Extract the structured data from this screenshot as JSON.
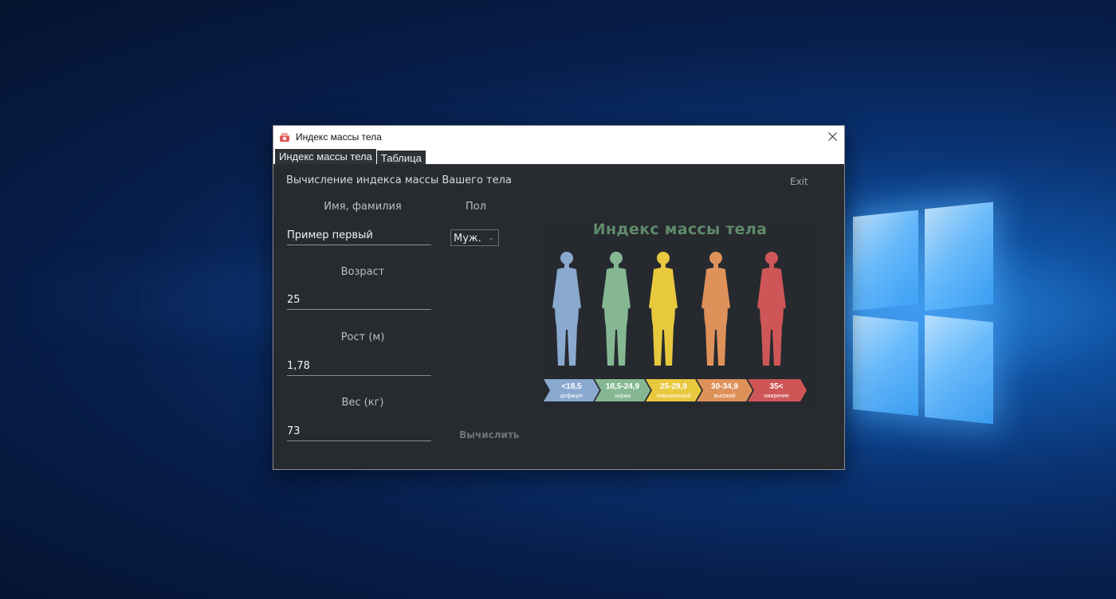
{
  "window": {
    "title": "Индекс массы тела",
    "tabs": [
      {
        "label": "Индекс массы тела",
        "active": true
      },
      {
        "label": "Таблица",
        "active": false
      }
    ]
  },
  "main": {
    "heading": "Вычисление индекса массы Вашего тела",
    "exit_label": "Exit",
    "name": {
      "label": "Имя, фамилия",
      "value": "Пример первый"
    },
    "gender": {
      "label": "Пол",
      "selected": "Муж."
    },
    "age": {
      "label": "Возраст",
      "value": "25"
    },
    "height": {
      "label": "Рост (м)",
      "value": "1,78"
    },
    "weight": {
      "label": "Вес (кг)",
      "value": "73"
    },
    "calculate_label": "Вычислить"
  },
  "bmi_image": {
    "title": "Индекс массы тела",
    "categories": [
      {
        "range": "<18,5",
        "name": "дефицит",
        "color": "#8aa9cf"
      },
      {
        "range": "18,5-24,9",
        "name": "норма",
        "color": "#85b892"
      },
      {
        "range": "25-29,9",
        "name": "повышенный",
        "color": "#e8c93e"
      },
      {
        "range": "30-34,9",
        "name": "высокий",
        "color": "#df915a"
      },
      {
        "range": "35<",
        "name": "ожирение",
        "color": "#cf5656"
      }
    ]
  }
}
